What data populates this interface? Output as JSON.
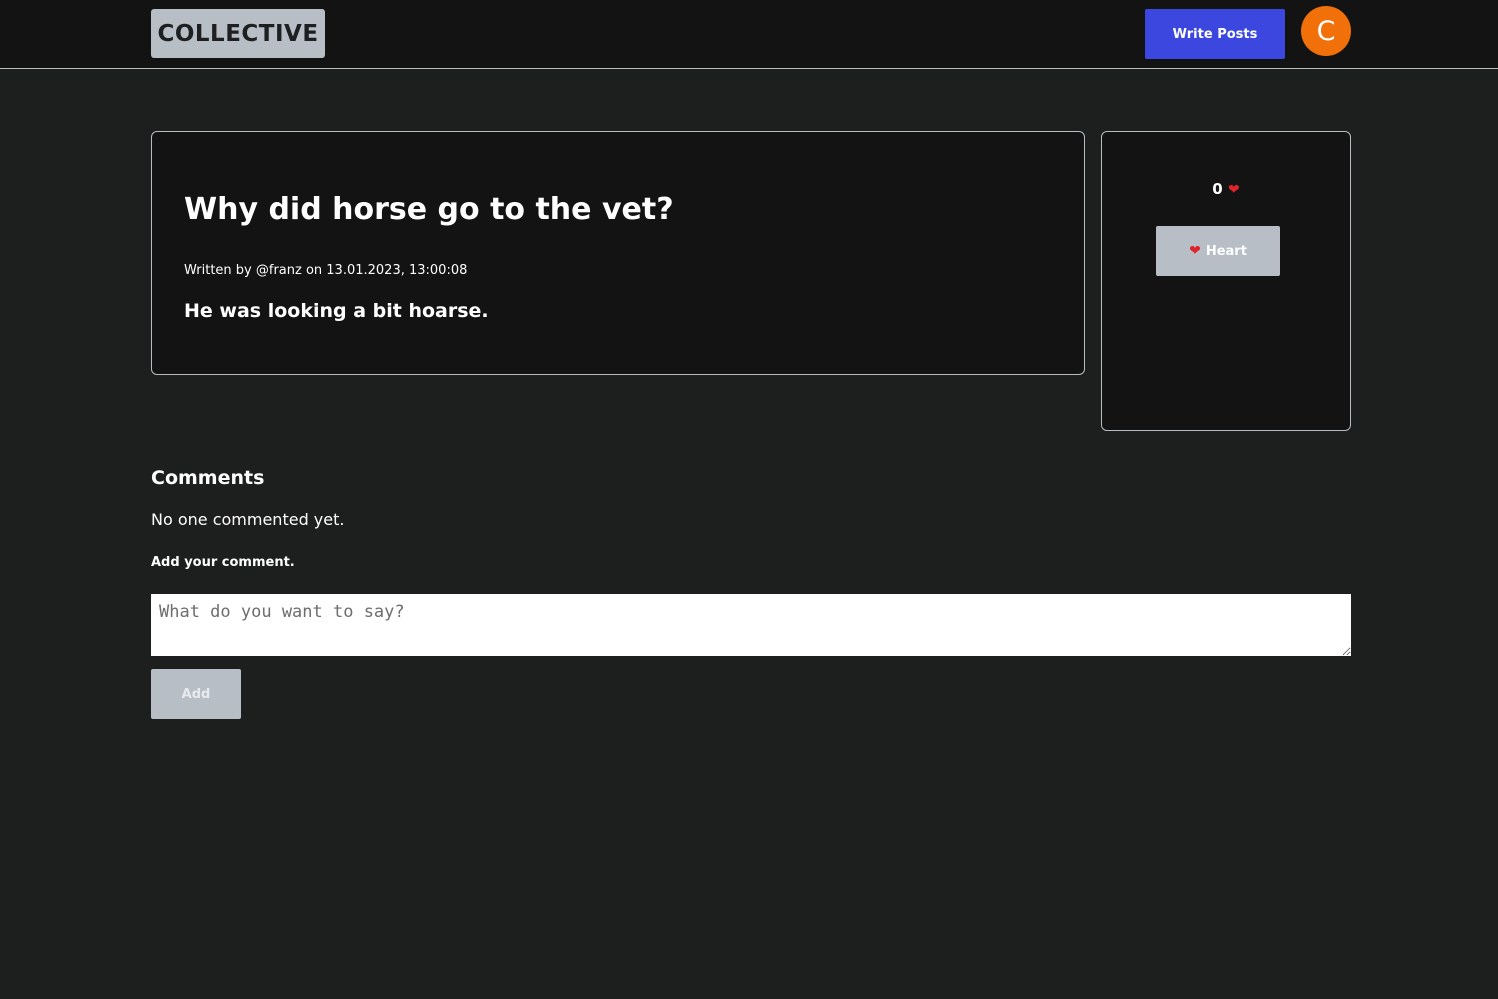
{
  "header": {
    "logo_text": "COLLECTIVE",
    "write_button_label": "Write Posts",
    "avatar_initial": "C"
  },
  "post": {
    "title": "Why did horse go to the vet?",
    "meta": "Written by @franz on 13.01.2023, 13:00:08",
    "body": "He was looking a bit hoarse."
  },
  "hearts": {
    "count": "0",
    "glyph": "❤",
    "button_label": "Heart"
  },
  "comments": {
    "heading": "Comments",
    "empty_message": "No one commented yet.",
    "add_label": "Add your comment.",
    "placeholder": "What do you want to say?",
    "value": "",
    "add_button_label": "Add"
  },
  "colors": {
    "page_bg": "#1d1e1e",
    "card_bg": "#131314",
    "accent": "#3c47e0",
    "avatar": "#f17009",
    "muted_button": "#b8bec6",
    "heart": "#e0242c"
  }
}
